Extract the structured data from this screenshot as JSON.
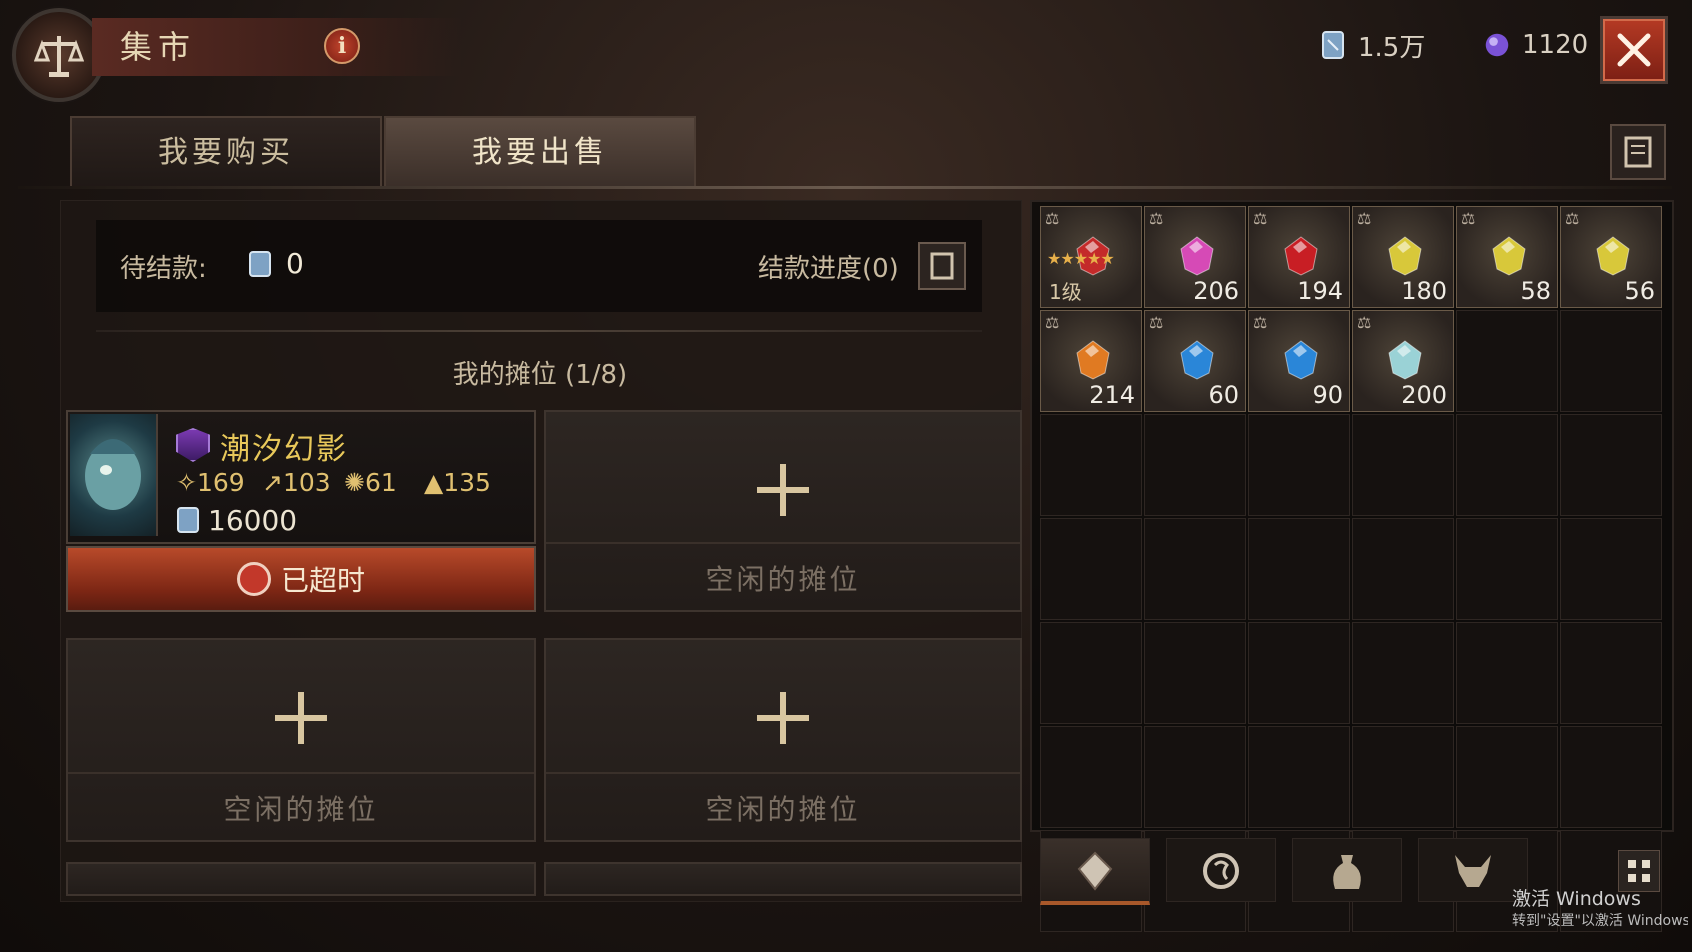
{
  "header": {
    "title": "集市",
    "info_label": "i",
    "currency": [
      {
        "icon": "silver-ticket-icon",
        "value": "1.5万"
      },
      {
        "icon": "purple-orb-icon",
        "value": "1120"
      }
    ],
    "close_icon": "close-icon"
  },
  "tabs": [
    {
      "label": "我要购买",
      "active": false
    },
    {
      "label": "我要出售",
      "active": true
    }
  ],
  "pending": {
    "label": "待结款:",
    "value": "0",
    "progress_label": "结款进度(0)"
  },
  "stall": {
    "title": "我的摊位 (1/8)",
    "occupied": {
      "name": "潮汐幻影",
      "stats": [
        "169",
        "103",
        "61",
        "135"
      ],
      "price": "16000",
      "status": "已超时"
    },
    "empty_label": "空闲的摊位"
  },
  "inventory": {
    "items": [
      {
        "type": "equipment",
        "level": "1级",
        "stars": "★★★★★",
        "color": "#c42a2a"
      },
      {
        "qty": "206",
        "color": "#d64ab6"
      },
      {
        "qty": "194",
        "color": "#c81e24"
      },
      {
        "qty": "180",
        "color": "#d8c83a"
      },
      {
        "qty": "58",
        "color": "#d8c83a"
      },
      {
        "qty": "56",
        "color": "#d8c83a"
      },
      {
        "qty": "214",
        "color": "#e07a22"
      },
      {
        "qty": "60",
        "color": "#2a86d8"
      },
      {
        "qty": "90",
        "color": "#2a86d8"
      },
      {
        "qty": "200",
        "color": "#9ad2d6"
      }
    ]
  },
  "categories": [
    {
      "icon": "gem-category-icon",
      "active": true
    },
    {
      "icon": "rune-category-icon",
      "active": false
    },
    {
      "icon": "bag-category-icon",
      "active": false
    },
    {
      "icon": "demon-category-icon",
      "active": false
    }
  ],
  "watermark": {
    "line1": "激活 Windows",
    "line2": "转到\"设置\"以激活 Windows"
  },
  "colors": {
    "accent": "#a8582a",
    "gold": "#e8c85a",
    "danger": "#b84a2a"
  }
}
